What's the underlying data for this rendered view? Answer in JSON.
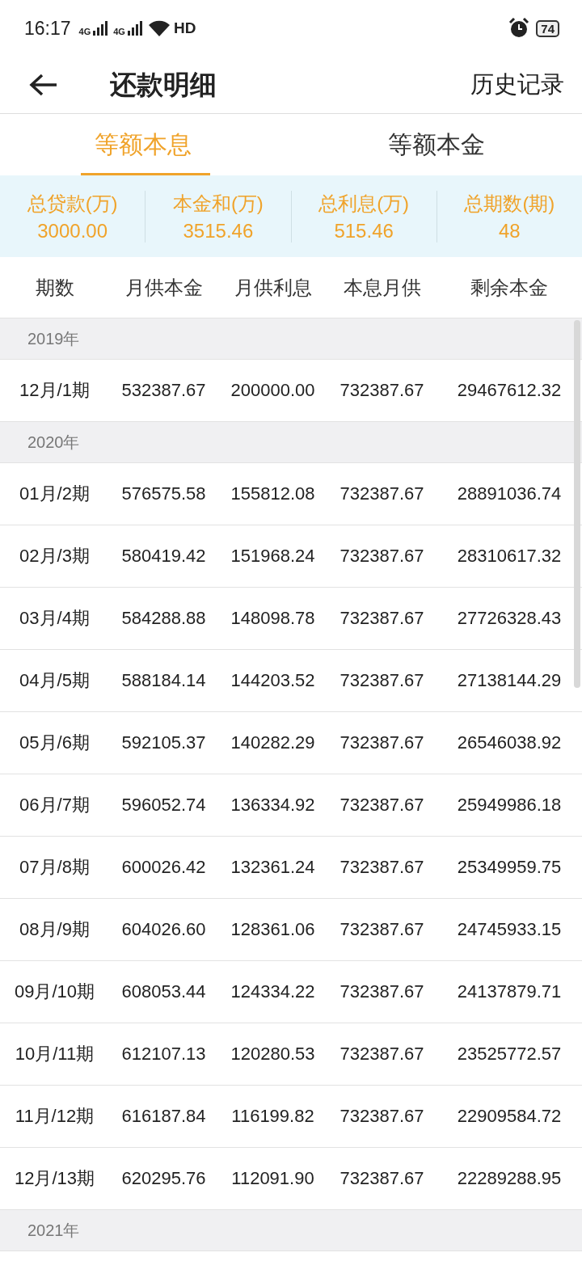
{
  "status_bar": {
    "time": "16:17",
    "network_labels": [
      "4G",
      "4G"
    ],
    "hd": "HD",
    "battery": "74"
  },
  "header": {
    "title": "还款明细",
    "action": "历史记录"
  },
  "tabs": [
    {
      "label": "等额本息",
      "selected": true
    },
    {
      "label": "等额本金",
      "selected": false
    }
  ],
  "summary": [
    {
      "label": "总贷款(万)",
      "value": "3000.00"
    },
    {
      "label": "本金和(万)",
      "value": "3515.46"
    },
    {
      "label": "总利息(万)",
      "value": "515.46"
    },
    {
      "label": "总期数(期)",
      "value": "48"
    }
  ],
  "table": {
    "columns": [
      "期数",
      "月供本金",
      "月供利息",
      "本息月供",
      "剩余本金"
    ],
    "groups": [
      {
        "year": "2019年",
        "rows": [
          [
            "12月/1期",
            "532387.67",
            "200000.00",
            "732387.67",
            "29467612.32"
          ]
        ]
      },
      {
        "year": "2020年",
        "rows": [
          [
            "01月/2期",
            "576575.58",
            "155812.08",
            "732387.67",
            "28891036.74"
          ],
          [
            "02月/3期",
            "580419.42",
            "151968.24",
            "732387.67",
            "28310617.32"
          ],
          [
            "03月/4期",
            "584288.88",
            "148098.78",
            "732387.67",
            "27726328.43"
          ],
          [
            "04月/5期",
            "588184.14",
            "144203.52",
            "732387.67",
            "27138144.29"
          ],
          [
            "05月/6期",
            "592105.37",
            "140282.29",
            "732387.67",
            "26546038.92"
          ],
          [
            "06月/7期",
            "596052.74",
            "136334.92",
            "732387.67",
            "25949986.18"
          ],
          [
            "07月/8期",
            "600026.42",
            "132361.24",
            "732387.67",
            "25349959.75"
          ],
          [
            "08月/9期",
            "604026.60",
            "128361.06",
            "732387.67",
            "24745933.15"
          ],
          [
            "09月/10期",
            "608053.44",
            "124334.22",
            "732387.67",
            "24137879.71"
          ],
          [
            "10月/11期",
            "612107.13",
            "120280.53",
            "732387.67",
            "23525772.57"
          ],
          [
            "11月/12期",
            "616187.84",
            "116199.82",
            "732387.67",
            "22909584.72"
          ],
          [
            "12月/13期",
            "620295.76",
            "112091.90",
            "732387.67",
            "22289288.95"
          ]
        ]
      },
      {
        "year": "2021年"
      }
    ]
  }
}
